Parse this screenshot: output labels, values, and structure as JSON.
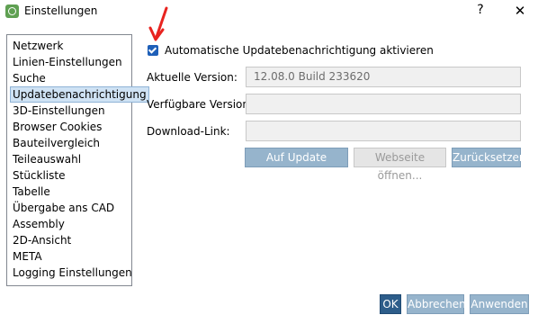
{
  "window": {
    "title": "Einstellungen",
    "help_label": "?",
    "close_label": "✕"
  },
  "sidebar": {
    "items": [
      {
        "label": "Netzwerk"
      },
      {
        "label": "Linien-Einstellungen"
      },
      {
        "label": "Suche"
      },
      {
        "label": "Updatebenachrichtigung",
        "selected": true
      },
      {
        "label": "3D-Einstellungen"
      },
      {
        "label": "Browser Cookies"
      },
      {
        "label": "Bauteilvergleich"
      },
      {
        "label": "Teileauswahl"
      },
      {
        "label": "Stückliste"
      },
      {
        "label": "Tabelle"
      },
      {
        "label": "Übergabe ans CAD"
      },
      {
        "label": "Assembly"
      },
      {
        "label": "2D-Ansicht"
      },
      {
        "label": "META"
      },
      {
        "label": "Logging Einstellungen"
      }
    ]
  },
  "panel": {
    "auto_update": {
      "label": "Automatische Updatebenachrichtigung aktivieren",
      "checked": true
    },
    "current_version": {
      "label": "Aktuelle Version:",
      "value": "12.08.0 Build 233620"
    },
    "available_version": {
      "label": "Verfügbare Version:",
      "value": ""
    },
    "download_link": {
      "label": "Download-Link:",
      "value": ""
    },
    "buttons": {
      "check_update": "Auf Update prüfen...",
      "open_website": "Webseite öffnen...",
      "reset": "Zurücksetzen"
    }
  },
  "footer": {
    "ok": "OK",
    "cancel": "Abbrechen",
    "apply": "Anwenden"
  },
  "colors": {
    "annotation_arrow": "#e8231f",
    "selection": "#cfe2f4",
    "checkbox": "#1e5fb8",
    "button_blue": "#96b4cc",
    "ok_button": "#2d5d8a"
  }
}
